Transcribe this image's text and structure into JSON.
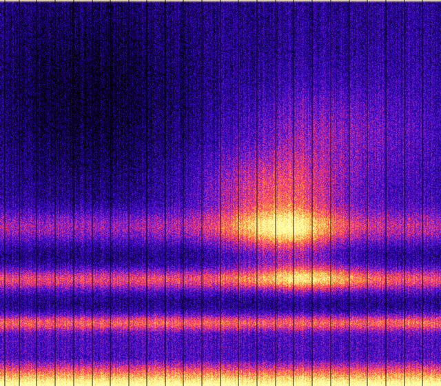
{
  "image": {
    "kind": "spectrogram-heatmap",
    "colormap": [
      "#000000",
      "#12004a",
      "#2a06b0",
      "#5a14d8",
      "#b02aa8",
      "#ff3a6a",
      "#ff8a3c",
      "#ffe06a",
      "#ffffb0"
    ],
    "background": "#05021a",
    "gridline_color": "#000000",
    "top_border_color": "#fff2c0"
  }
}
